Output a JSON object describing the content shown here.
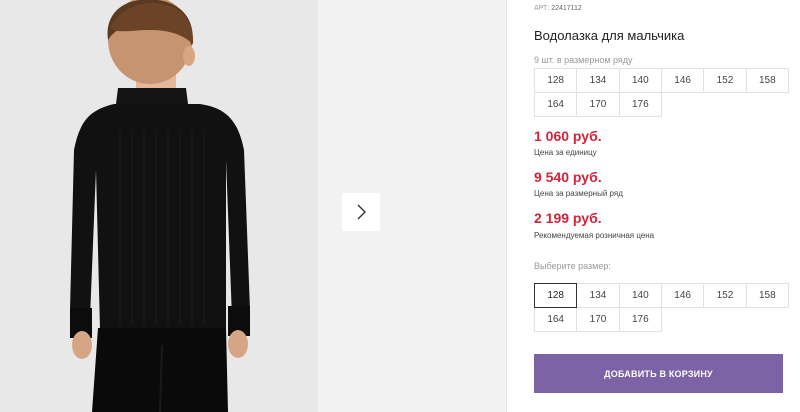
{
  "product": {
    "article_label": "АРТ:",
    "article_value": "22417112",
    "title": "Водолазка для мальчика"
  },
  "size_grid": {
    "note": "9 шт. в размерном ряду",
    "sizes": [
      "128",
      "134",
      "140",
      "146",
      "152",
      "158",
      "164",
      "170",
      "176"
    ]
  },
  "prices": [
    {
      "value": "1 060 руб.",
      "label": "Цена за единицу"
    },
    {
      "value": "9 540 руб.",
      "label": "Цена за размерный ряд"
    },
    {
      "value": "2 199 руб.",
      "label": "Рекомендуемая розничная цена"
    }
  ],
  "size_select": {
    "label": "Выберите размер:",
    "selected": "128",
    "sizes": [
      "128",
      "134",
      "140",
      "146",
      "152",
      "158",
      "164",
      "170",
      "176"
    ]
  },
  "cart_button": "ДОБАВИТЬ В КОРЗИНУ",
  "icons": {
    "next": "chevron-right-icon",
    "photo": "product-photo"
  },
  "colors": {
    "price": "#d2243b",
    "button": "#7b63a5"
  }
}
